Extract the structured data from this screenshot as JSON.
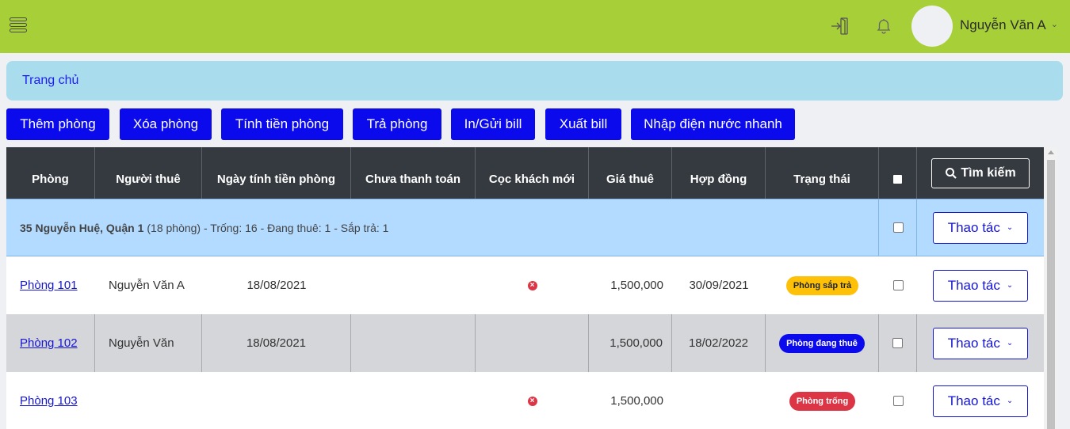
{
  "header": {
    "username": "Nguyễn Văn A"
  },
  "breadcrumb": {
    "home": "Trang chủ"
  },
  "actions": [
    "Thêm phòng",
    "Xóa phòng",
    "Tính tiền phòng",
    "Trả phòng",
    "In/Gửi bill",
    "Xuất bill",
    "Nhập điện nước nhanh"
  ],
  "table": {
    "columns": [
      "Phòng",
      "Người thuê",
      "Ngày tính tiền phòng",
      "Chưa thanh toán",
      "Cọc khách mới",
      "Giá thuê",
      "Hợp đồng",
      "Trạng thái"
    ],
    "search_label": "Tìm kiếm",
    "group": {
      "address": "35 Nguyễn Huệ, Quận 1",
      "summary": "(18 phòng) - Trống: 16 - Đang thuê: 1 - Sắp trả: 1"
    },
    "action_label": "Thao tác",
    "rows": [
      {
        "room": "Phòng 101",
        "tenant": "Nguyễn Văn A",
        "billing_date": "18/08/2021",
        "unpaid": "",
        "deposit_unpaid_icon": true,
        "rent": "1,500,000",
        "contract": "30/09/2021",
        "status": "Phòng sắp trả",
        "status_color": "#ffc107",
        "status_text_color": "#212529"
      },
      {
        "room": "Phòng 102",
        "tenant": "Nguyễn Văn",
        "billing_date": "18/08/2021",
        "unpaid": "",
        "deposit_unpaid_icon": false,
        "rent": "1,500,000",
        "contract": "18/02/2022",
        "status": "Phòng đang thuê",
        "status_color": "#0a0aec",
        "status_text_color": "#ffffff"
      },
      {
        "room": "Phòng 103",
        "tenant": "",
        "billing_date": "",
        "unpaid": "",
        "deposit_unpaid_icon": true,
        "rent": "1,500,000",
        "contract": "",
        "status": "Phòng trống",
        "status_color": "#dc3545",
        "status_text_color": "#ffffff"
      }
    ]
  },
  "colors": {
    "topbar": "#a6cf38",
    "primary": "#0a0aec",
    "header_bg": "#343a40",
    "group_bg": "#b3daff"
  }
}
